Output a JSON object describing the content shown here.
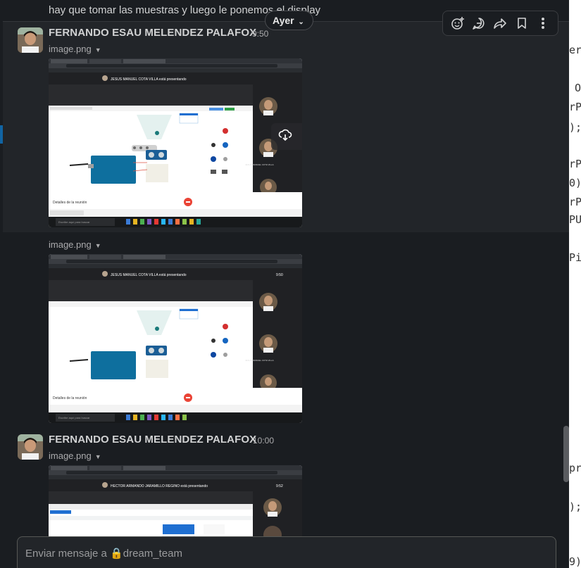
{
  "messages": {
    "previous_text": "hay que tomar las muestras y luego le ponemos el display",
    "date_divider": "Ayer",
    "group1": {
      "sender": "FERNANDO ESAU MELENDEZ PALAFOX",
      "time": "9:50",
      "files": [
        {
          "name": "image.png",
          "meet_banner": "JESUS MANUEL COTA VILLA está presentando",
          "participant": "JESUS MANUEL COTA VILLA",
          "meeting_details": "Detalles de la reunión",
          "taskbar_search": "Escribe aquí para buscar",
          "clock": "9:50"
        },
        {
          "name": "image.png",
          "meet_banner": "JESUS MANUEL COTA VILLA está presentando",
          "participant": "JESUS MANUEL COTA VILLA",
          "meeting_details": "Detalles de la reunión",
          "taskbar_search": "Escribe aquí para buscar",
          "clock": "9:50"
        }
      ]
    },
    "group2": {
      "sender": "FERNANDO ESAU MELENDEZ PALAFOX",
      "time": "10:00",
      "files": [
        {
          "name": "image.png",
          "meet_banner": "HECTOR ARMANDO JARAMILLO REGINO está presentando",
          "clock": "9:52"
        }
      ]
    }
  },
  "hover_actions": [
    "add-reaction-icon",
    "reply-in-thread-icon",
    "forward-icon",
    "bookmark-icon",
    "more-actions-icon"
  ],
  "image_tools": [
    "download-icon",
    "share-icon",
    "more-icon"
  ],
  "composer": {
    "placeholder": "Enviar mensaje a 🔒dream_team"
  },
  "background_code": [
    "er",
    "O",
    "rP",
    ");",
    "rP",
    "0)",
    "rP",
    "PU",
    "Pi",
    "pr",
    ");",
    "9)"
  ],
  "colors": {
    "background": "#1a1d21",
    "hover": "#222529",
    "accent": "#1164a3",
    "meet_end_call": "#ea4335"
  }
}
